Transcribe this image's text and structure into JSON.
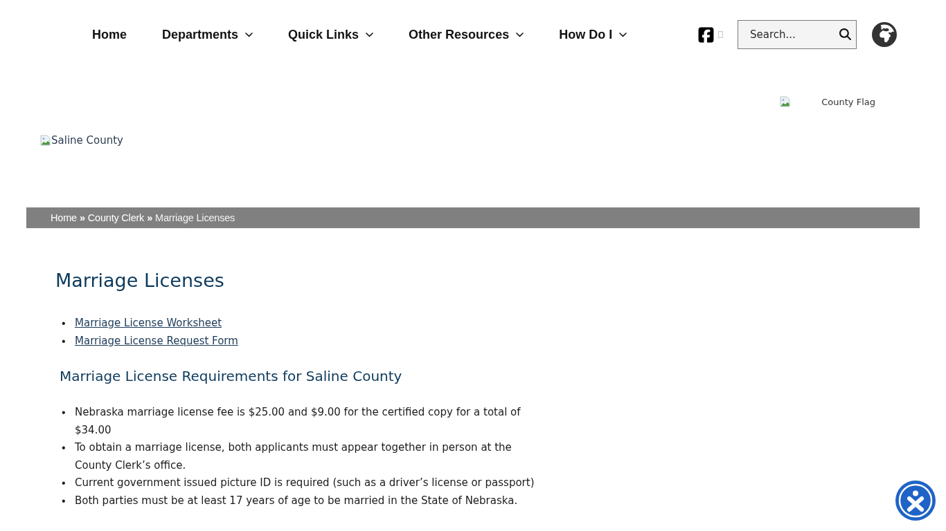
{
  "nav": {
    "items": [
      {
        "label": "Home",
        "has_dropdown": false
      },
      {
        "label": "Departments",
        "has_dropdown": true
      },
      {
        "label": "Quick Links",
        "has_dropdown": true
      },
      {
        "label": "Other Resources",
        "has_dropdown": true
      },
      {
        "label": "How Do I",
        "has_dropdown": true
      }
    ]
  },
  "search": {
    "placeholder": "Search..."
  },
  "header": {
    "flag_image": {
      "alt": "County Flag"
    },
    "logo_image": {
      "alt": "Saline County"
    }
  },
  "breadcrumb": {
    "items": [
      {
        "kind": "link",
        "text": "Home"
      },
      {
        "kind": "separator",
        "text": "»"
      },
      {
        "kind": "link",
        "text": "County Clerk"
      },
      {
        "kind": "separator",
        "text": "»"
      },
      {
        "kind": "current",
        "text": "Marriage Licenses"
      }
    ]
  },
  "page": {
    "title": "Marriage Licenses",
    "links": [
      {
        "marker": "•",
        "label": "Marriage License Worksheet"
      },
      {
        "marker": "•",
        "label": "Marriage License Request Form"
      }
    ],
    "sections": [
      {
        "heading": "Marriage License Requirements for Saline County",
        "items": [
          {
            "marker": "•",
            "text": "Nebraska marriage license fee is $25.00 and $9.00 for the certified copy for a total of $34.00"
          },
          {
            "marker": "•",
            "text": "To obtain a marriage license, both applicants must appear together in person at the County Clerk’s office."
          },
          {
            "marker": "•",
            "text": "Current government issued picture ID is required (such as a driver’s license or passport)"
          },
          {
            "marker": "•",
            "text": "Both parties must be at least 17 years of age to be married in the State of Nebraska."
          }
        ]
      }
    ]
  }
}
